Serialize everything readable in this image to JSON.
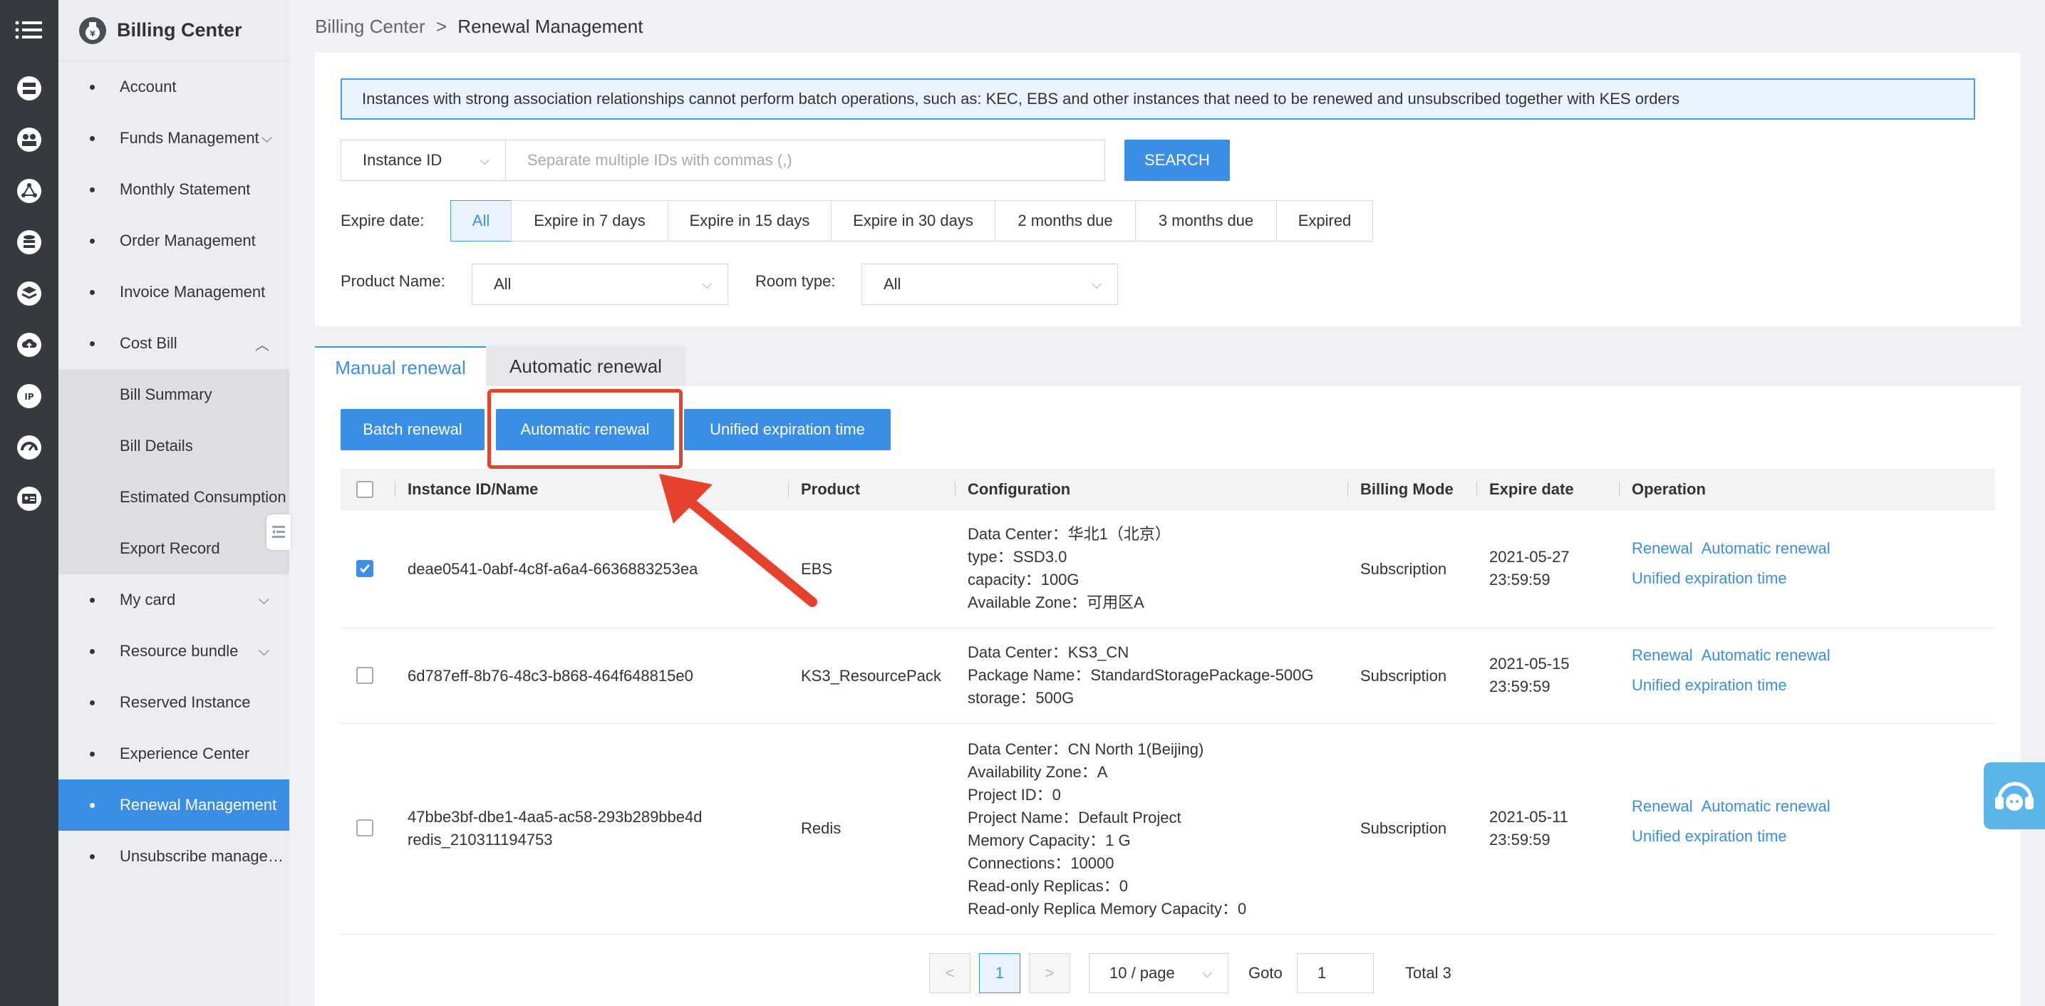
{
  "sidebar": {
    "title": "Billing Center",
    "items": [
      {
        "label": "Account",
        "chevron": ""
      },
      {
        "label": "Funds Management",
        "chevron": "⌵"
      },
      {
        "label": "Monthly Statement",
        "chevron": ""
      },
      {
        "label": "Order Management",
        "chevron": ""
      },
      {
        "label": "Invoice Management",
        "chevron": ""
      },
      {
        "label": "Cost Bill",
        "chevron": "︿"
      },
      {
        "label": "Bill Summary",
        "chevron": ""
      },
      {
        "label": "Bill Details",
        "chevron": ""
      },
      {
        "label": "Estimated Consumption",
        "chevron": ""
      },
      {
        "label": "Export Record",
        "chevron": ""
      },
      {
        "label": "My card",
        "chevron": "⌵"
      },
      {
        "label": "Resource bundle",
        "chevron": "⌵"
      },
      {
        "label": "Reserved Instance",
        "chevron": ""
      },
      {
        "label": "Experience Center",
        "chevron": ""
      },
      {
        "label": "Renewal Management",
        "chevron": ""
      },
      {
        "label": "Unsubscribe management",
        "chevron": ""
      }
    ]
  },
  "breadcrumb": {
    "parent": "Billing Center",
    "separator": ">",
    "current": "Renewal Management"
  },
  "notice": "Instances with strong association relationships cannot perform batch operations, such as: KEC, EBS and other instances that need to be renewed and unsubscribed together with KES orders",
  "search": {
    "type_value": "Instance ID",
    "placeholder": "Separate multiple IDs with commas (,)",
    "button": "SEARCH"
  },
  "expire_filter": {
    "label": "Expire date:",
    "options": [
      "All",
      "Expire in 7 days",
      "Expire in 15 days",
      "Expire in 30 days",
      "2 months due",
      "3 months due",
      "Expired"
    ],
    "selected": "All"
  },
  "product_filter": {
    "label": "Product Name:",
    "value": "All"
  },
  "room_filter": {
    "label": "Room type:",
    "value": "All"
  },
  "tabs": [
    "Manual renewal",
    "Automatic renewal"
  ],
  "actions": {
    "batch": "Batch renewal",
    "auto": "Automatic renewal",
    "unified": "Unified expiration time"
  },
  "table": {
    "headers": [
      "Instance ID/Name",
      "Product",
      "Configuration",
      "Billing Mode",
      "Expire date",
      "Operation"
    ],
    "rows": [
      {
        "checked": true,
        "id": "deae0541-0abf-4c8f-a6a4-6636883253ea",
        "name": "",
        "product": "EBS",
        "config": [
          "Data Center：华北1（北京）",
          "type：SSD3.0",
          "capacity：100G",
          "Available Zone：可用区A"
        ],
        "mode": "Subscription",
        "date": "2021-05-27",
        "time": "23:59:59"
      },
      {
        "checked": false,
        "id": "6d787eff-8b76-48c3-b868-464f648815e0",
        "name": "",
        "product": "KS3_ResourcePack",
        "config": [
          "Data Center：KS3_CN",
          "Package Name：StandardStoragePackage-500G",
          "storage：500G"
        ],
        "mode": "Subscription",
        "date": "2021-05-15",
        "time": "23:59:59"
      },
      {
        "checked": false,
        "id": "47bbe3bf-dbe1-4aa5-ac58-293b289bbe4d",
        "name": "redis_210311194753",
        "product": "Redis",
        "config": [
          "Data Center：CN North 1(Beijing)",
          "Availability Zone：A",
          "Project ID：0",
          "Project Name：Default Project",
          "Memory Capacity：1 G",
          "Connections：10000",
          "Read-only Replicas：0",
          "Read-only Replica Memory Capacity：0"
        ],
        "mode": "Subscription",
        "date": "2021-05-11",
        "time": "23:59:59"
      }
    ],
    "op_renewal": "Renewal",
    "op_auto": "Automatic renewal",
    "op_unified": "Unified expiration time"
  },
  "pagination": {
    "prev": "<",
    "page": "1",
    "next": ">",
    "per_page": "10 / page",
    "goto_label": "Goto",
    "goto_value": "1",
    "total": "Total 3"
  },
  "colors": {
    "accent": "#3a8ee6",
    "highlight": "#e5412c",
    "iconbar": "#363a40"
  }
}
